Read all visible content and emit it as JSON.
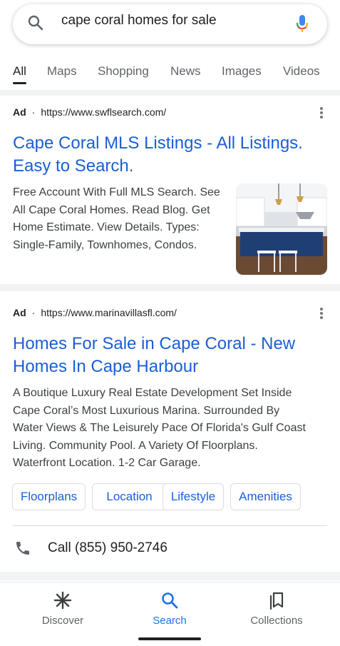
{
  "search": {
    "query": "cape coral homes for sale"
  },
  "tabs": [
    {
      "label": "All",
      "active": true
    },
    {
      "label": "Maps",
      "active": false
    },
    {
      "label": "Shopping",
      "active": false
    },
    {
      "label": "News",
      "active": false
    },
    {
      "label": "Images",
      "active": false
    },
    {
      "label": "Videos",
      "active": false
    }
  ],
  "ads": [
    {
      "ad_label": "Ad",
      "separator": "·",
      "url": "https://www.swflsearch.com/",
      "title_line1": "Cape Coral MLS Listings - All Listings.",
      "title_line2": "Easy to Search.",
      "desc_lines": [
        "Free Account With Full MLS Search. See",
        "All Cape Coral Homes. Read Blog. Get",
        "Home Estimate. View Details. Types:",
        "Single-Family, Townhomes, Condos."
      ]
    },
    {
      "ad_label": "Ad",
      "separator": "·",
      "url": "https://www.marinavillasfl.com/",
      "title_line1": "Homes For Sale in Cape Coral - New",
      "title_line2": "Homes In Cape Harbour",
      "desc_lines": [
        "A Boutique Luxury Real Estate Development Set Inside",
        "Cape Coral’s Most Luxurious Marina. Surrounded By",
        "Water Views & The Leisurely Pace Of Florida's Gulf Coast",
        "Living. Community Pool. A Variety Of Floorplans.",
        "Waterfront Location. 1-2 Car Garage."
      ],
      "sitelinks": [
        "Floorplans",
        "Location",
        "Lifestyle",
        "Amenities"
      ],
      "call": "Call (855) 950-2746"
    }
  ],
  "bottom_nav": [
    {
      "label": "Discover",
      "icon": "asterisk-icon",
      "active": false
    },
    {
      "label": "Search",
      "icon": "search-icon",
      "active": true
    },
    {
      "label": "Collections",
      "icon": "collections-icon",
      "active": false
    }
  ],
  "colors": {
    "link_blue": "#1a5fd6",
    "active_nav": "#1a73e8",
    "divider": "#f1f3f4"
  }
}
